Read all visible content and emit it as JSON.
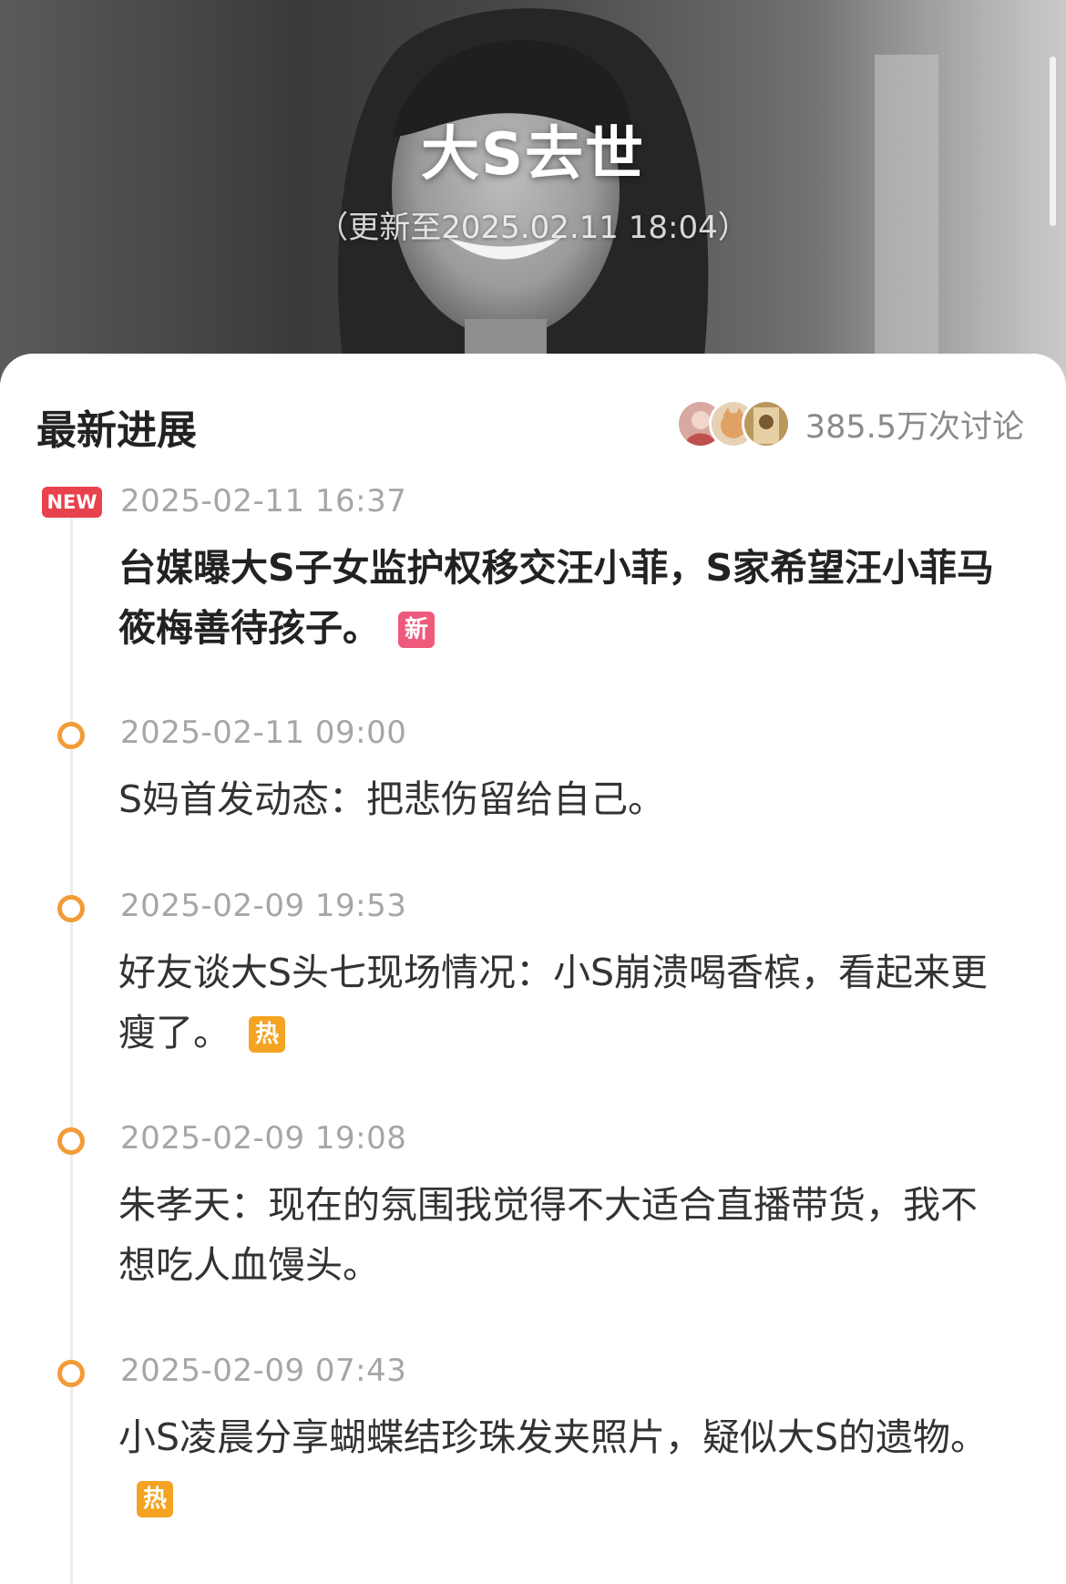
{
  "hero": {
    "title": "大S去世",
    "subtitle": "（更新至2025.02.11 18:04）"
  },
  "section": {
    "title": "最新进展",
    "discussion_count": "385.5万次讨论",
    "avatars": [
      "avatar-1",
      "avatar-2",
      "avatar-3"
    ]
  },
  "timeline": [
    {
      "badge": "NEW",
      "time": "2025-02-11 16:37",
      "text": "台媒曝大S子女监护权移交汪小菲，S家希望汪小菲马筱梅善待孩子。",
      "tag": "新"
    },
    {
      "time": "2025-02-11 09:00",
      "text": "S妈首发动态：把悲伤留给自己。",
      "tag": ""
    },
    {
      "time": "2025-02-09 19:53",
      "text": "好友谈大S头七现场情况：小S崩溃喝香槟，看起来更瘦了。",
      "tag": "热"
    },
    {
      "time": "2025-02-09 19:08",
      "text": "朱孝天：现在的氛围我觉得不大适合直播带货，我不想吃人血馒头。",
      "tag": ""
    },
    {
      "time": "2025-02-09 07:43",
      "text": "小S凌晨分享蝴蝶结珍珠发夹照片，疑似大S的遗物。",
      "tag": "热"
    }
  ],
  "colors": {
    "accent_orange": "#f29b38",
    "new_badge": "#e8424d",
    "tag_new": "#ef5a7c",
    "tag_hot": "#f5a323"
  }
}
